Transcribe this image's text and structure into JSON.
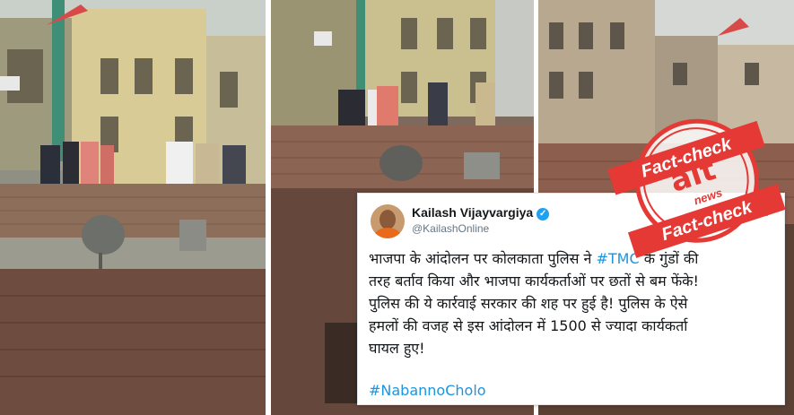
{
  "tweet": {
    "name": "Kailash Vijayvargiya",
    "handle": "@KailashOnline",
    "body_lines": [
      {
        "pre": "भाजपा के आंदोलन पर कोलकाता पुलिस ने ",
        "tag": "#TMC",
        "post": " के गुंडों की"
      },
      {
        "text": "तरह बर्ताव किया और भाजपा कार्यकर्ताओं पर छतों से बम फेंके!"
      },
      {
        "text": "पुलिस की ये कार्रवाई सरकार की शह पर हुई है! पुलिस के ऐसे"
      },
      {
        "text": "हमलों की वजह से इस आंदोलन में 1500 से ज्यादा कार्यकर्ता"
      },
      {
        "text": "घायल हुए!"
      }
    ],
    "hashtag": "#NabannoCholo"
  },
  "stamp": {
    "top_text": "Fact-check",
    "bottom_text": "Fact-check",
    "logo_alt": "alt",
    "logo_news": "news",
    "color": "#e53935"
  }
}
